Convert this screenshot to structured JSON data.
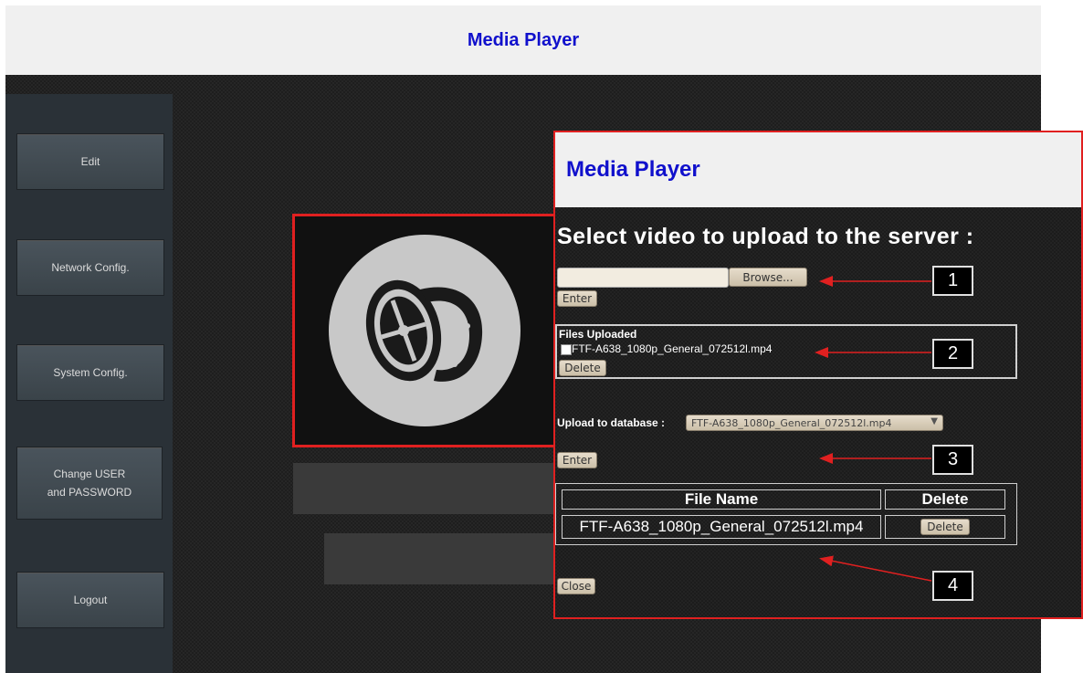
{
  "topbar": {
    "title": "Media Player"
  },
  "sidebar": {
    "items": [
      {
        "label": "Edit"
      },
      {
        "label": "Network Config."
      },
      {
        "label": "System Config."
      },
      {
        "label": "Change USER and PASSWORD"
      },
      {
        "label": "Logout"
      }
    ]
  },
  "dialog": {
    "title": "Media Player",
    "heading": "Select video to upload to the server :",
    "file_input": {
      "value": "",
      "browse_label": "Browse..."
    },
    "enter_label": "Enter",
    "files_uploaded": {
      "title": "Files Uploaded",
      "file_name": "FTF-A638_1080p_General_072512l.mp4",
      "delete_label": "Delete"
    },
    "upload_db": {
      "label": "Upload to database :",
      "selected": "FTF-A638_1080p_General_072512l.mp4",
      "enter_label": "Enter"
    },
    "table": {
      "headers": [
        "File Name",
        "Delete"
      ],
      "rows": [
        {
          "file_name": "FTF-A638_1080p_General_072512l.mp4",
          "delete_label": "Delete"
        }
      ]
    },
    "close_label": "Close"
  },
  "callouts": [
    "1",
    "2",
    "3",
    "4"
  ],
  "colors": {
    "title": "#1010cc",
    "highlight": "#e02020"
  },
  "icons": {
    "logo": "film-reel-icon",
    "select_arrow": "triangle-down-icon"
  }
}
